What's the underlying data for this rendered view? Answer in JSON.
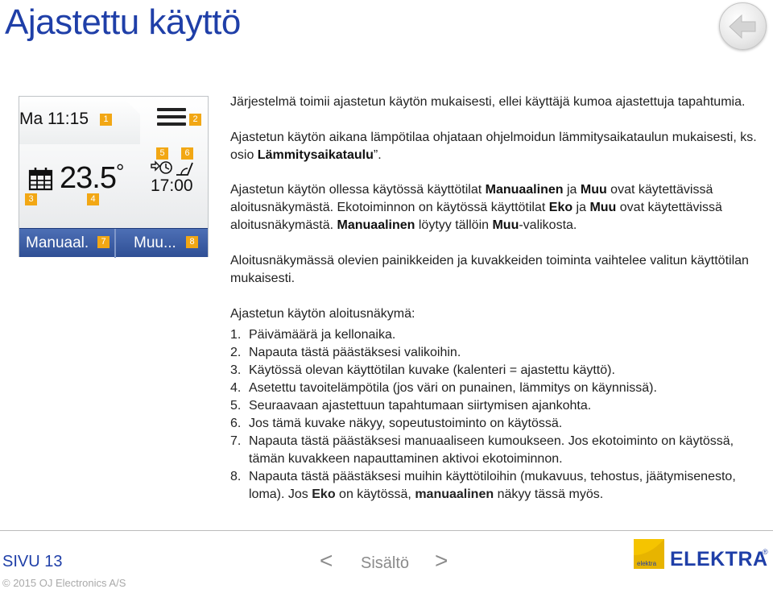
{
  "page": {
    "title": "Ajastettu käyttö",
    "back_icon": "back-arrow-icon"
  },
  "device": {
    "datetime": "Ma 11:15",
    "temperature": "23.5",
    "temperature_unit": "°",
    "clock": "17:00",
    "left_button": "Manuaal.",
    "right_button": "Muu...",
    "badges": [
      "1",
      "2",
      "3",
      "4",
      "5",
      "6",
      "7",
      "8"
    ],
    "icons": [
      "calendar-icon",
      "menu-icon",
      "adaptive-clock-icon",
      "window-open-icon"
    ]
  },
  "intro": {
    "p1": "Järjestelmä toimii ajastetun käytön mukaisesti, ellei käyttäjä kumoa ajastettuja tapahtumia.",
    "p2a": "Ajastetun käytön aikana lämpötilaa ohjataan ohjelmoidun lämmitysaikataulun mukaisesti, ks. osio ",
    "p2b": "Lämmitysaikataulu",
    "p2c": "”.",
    "p3a": "Ajastetun käytön ollessa käytössä käyttötilat ",
    "p3b": "Manuaalinen",
    "p3c": " ja ",
    "p3d": "Muu",
    "p3e": " ovat käytettävissä aloitusnäkymästä. Ekotoiminnon on käytössä käyttötilat ",
    "p3f": "Eko",
    "p3g": " ja ",
    "p3h": "Muu",
    "p3i": " ovat käytettävissä aloitusnäkymästä. ",
    "p3j": "Manuaalinen",
    "p3k": " löytyy tällöin ",
    "p3l": "Muu",
    "p3m": "-valikosta.",
    "p4": "Aloitusnäkymässä olevien painikkeiden ja kuvakkeiden toiminta vaihtelee valitun käyttötilan mukaisesti."
  },
  "list": {
    "heading": "Ajastetun käytön aloitusnäkymä:",
    "items": [
      {
        "n": "1.",
        "text": "Päivämäärä ja kellonaika."
      },
      {
        "n": "2.",
        "text": "Napauta tästä päästäksesi valikoihin."
      },
      {
        "n": "3.",
        "text": "Käytössä olevan käyttötilan kuvake (kalenteri = ajastettu käyttö)."
      },
      {
        "n": "4.",
        "text": "Asetettu tavoitelämpötila (jos väri on punainen, lämmitys on käynnissä)."
      },
      {
        "n": "5.",
        "text": "Seuraavaan ajastettuun tapahtumaan siirtymisen ajankohta."
      },
      {
        "n": "6.",
        "text": "Jos tämä kuvake näkyy, sopeutustoiminto on käytössä."
      },
      {
        "n": "7.",
        "text": "Napauta tästä päästäksesi manuaaliseen kumoukseen. Jos ekotoiminto on käytössä, tämän kuvakkeen napauttaminen aktivoi ekotoiminnon."
      },
      {
        "n": "8.",
        "text_a": "Napauta tästä päästäksesi muihin käyttötiloihin (mukavuus, tehostus, jäätymisenesto, loma). Jos ",
        "text_b": "Eko",
        "text_c": " on käytössä, ",
        "text_d": "manuaalinen",
        "text_e": " näkyy tässä myös."
      }
    ]
  },
  "footer": {
    "page_label": "SIVU 13",
    "prev": "<",
    "toc": "Sisältö",
    "next": ">",
    "copyright": "© 2015 OJ Electronics A/S",
    "logo_small": "elektra",
    "logo_text": "ELEKTRA",
    "logo_reg": "®"
  },
  "colors": {
    "accent": "#1f3fa8",
    "badge": "#f2a714",
    "device_bar": "#2f4f95"
  }
}
